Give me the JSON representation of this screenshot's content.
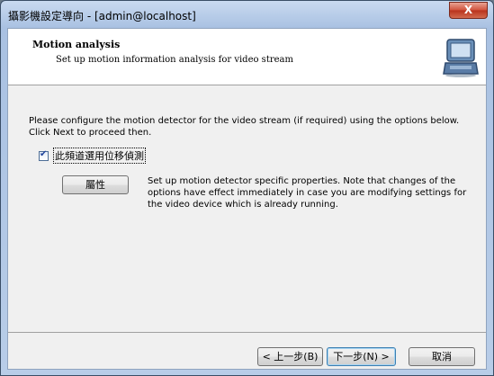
{
  "window": {
    "title": "攝影機設定導向 - [admin@localhost]",
    "close_label": "X"
  },
  "header": {
    "title": "Motion analysis",
    "subtitle": "Set up motion information analysis for video stream",
    "icon": "laptop-icon"
  },
  "content": {
    "description": "Please configure the motion detector for the video stream (if required) using the options below. Click Next to proceed then.",
    "checkbox": {
      "label": "此頻道選用位移偵測",
      "checked": true
    },
    "properties_button": "屬性",
    "properties_text": "Set up motion detector specific properties. Note that changes of the options have effect immediately in case you are modifying settings for the video device which is already running."
  },
  "footer": {
    "back_label": "< 上一步(B)",
    "next_label": "下一步(N) >",
    "cancel_label": "取消"
  }
}
